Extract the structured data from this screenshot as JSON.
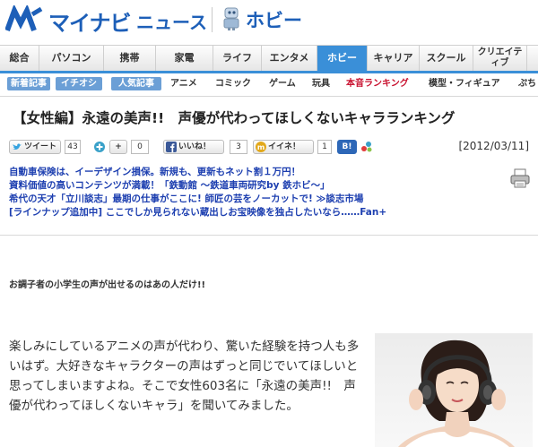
{
  "header": {
    "brand": "マイナビ",
    "section_name": "ニュース",
    "channel": "ホビー"
  },
  "main_nav": {
    "items": [
      "総合",
      "パソコン",
      "携帯",
      "家電",
      "ライフ",
      "エンタメ",
      "ホビー",
      "キャリア",
      "スクール",
      "クリエイティブ"
    ],
    "active": "ホビー",
    "colors": {
      "accent": "#3a8fd8",
      "brand": "#1d5fb8"
    }
  },
  "sub_nav": {
    "tags": [
      "新着記事",
      "イチオシ",
      "人気記事"
    ],
    "links": [
      "アニメ",
      "コミック",
      "ゲーム",
      "玩具",
      "本音ランキング",
      "模型・フィギュア",
      "ぷち"
    ]
  },
  "article": {
    "title": "【女性編】永遠の美声!!　声優が代わってほしくないキャラランキング",
    "date": "[2012/03/11]",
    "lead": "お調子者の小学生の声が出せるのはあの人だけ!!",
    "body": "楽しみにしているアニメの声が代わり、驚いた経験を持つ人も多いはず。大好きなキャラクターの声はずっと同じでいてほしいと思ってしまいますよね。そこで女性603名に「永遠の美声!!　声優が代わってほしくないキャラ」を聞いてみました。"
  },
  "social": {
    "tweet_label": "ツイート",
    "tweet_count": "43",
    "plus_count": "0",
    "like_label": "いいね！",
    "like_count": "3",
    "iine_label": "イイネ！",
    "iine_count": "1",
    "hatena_label": "B!"
  },
  "ads": [
    "自動車保険は、イーデザイン損保。新規も、更新もネット割１万円！",
    "資料価値の高いコンテンツが満載！「鉄動館 ～鉄道車両研究by 鉄ホビ～」",
    "希代の天才「立川談志」最期の仕事がここに! 師匠の芸をノーカットで! ≫談志市場",
    "[ラインナップ追加中] ここでしか見られない蔵出しお宝映像を独占したいなら……Fan+"
  ],
  "icons": [
    "mynavi-logo-icon",
    "hobby-robot-icon",
    "twitter-bird-icon",
    "plus-icon",
    "facebook-icon",
    "iine-icon",
    "hatena-icon",
    "share-icon",
    "print-icon"
  ]
}
